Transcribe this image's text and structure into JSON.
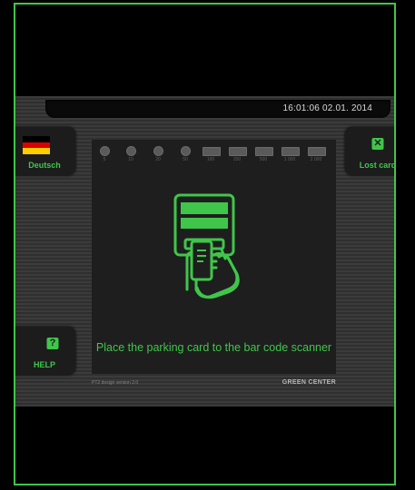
{
  "header": {
    "datetime": "16:01:06  02.01. 2014"
  },
  "language_button": {
    "label": "Deutsch",
    "flag_colors": [
      "#000000",
      "#dd0000",
      "#ffce00"
    ]
  },
  "lost_card_button": {
    "label": "Lost card",
    "icon": "x-icon"
  },
  "help_button": {
    "label": "HELP",
    "icon": "question-icon"
  },
  "denominations": [
    "5",
    "10",
    "20",
    "50",
    "100",
    "200",
    "500",
    "1 000",
    "2 000"
  ],
  "main": {
    "instruction": "Place the parking card to the bar code scanner",
    "illustration": "card-scanner-hand-icon"
  },
  "footer": {
    "version": "PT2 design version 2.0",
    "brand": "GREEN CENTER"
  },
  "colors": {
    "accent": "#3fc64a",
    "panel": "#333333",
    "screen": "#1e1e1e"
  }
}
